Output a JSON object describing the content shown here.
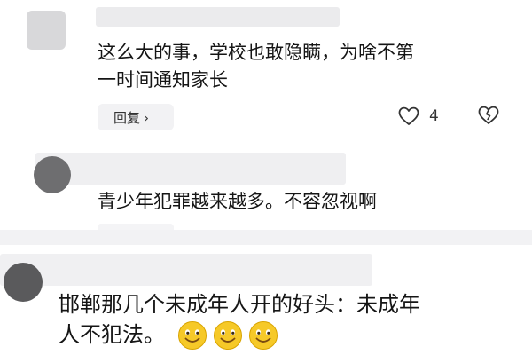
{
  "comments": [
    {
      "text_lines": [
        "这么大的事，学校也敢隐瞒，为啥不第",
        "一时间通知家长"
      ],
      "reply_label": "回复",
      "reply_chevron": "›",
      "like_count": "4",
      "icons": [
        "heart-outline-icon",
        "broken-heart-icon"
      ]
    },
    {
      "text_lines": [
        "青少年犯罪越来越多。不容忽视啊"
      ]
    },
    {
      "text_lines": [
        "邯郸那几个未成年人开的好头：未成年",
        "人不犯法。"
      ],
      "emoji_icons": [
        "smiling-face-icon",
        "smiling-face-icon",
        "smiling-face-icon"
      ]
    }
  ],
  "colors": {
    "background": "#ffffff",
    "divider": "#f2f2f4",
    "reply_button_bg": "#f2f2f4",
    "emoji_yellow": "#f6c928"
  }
}
